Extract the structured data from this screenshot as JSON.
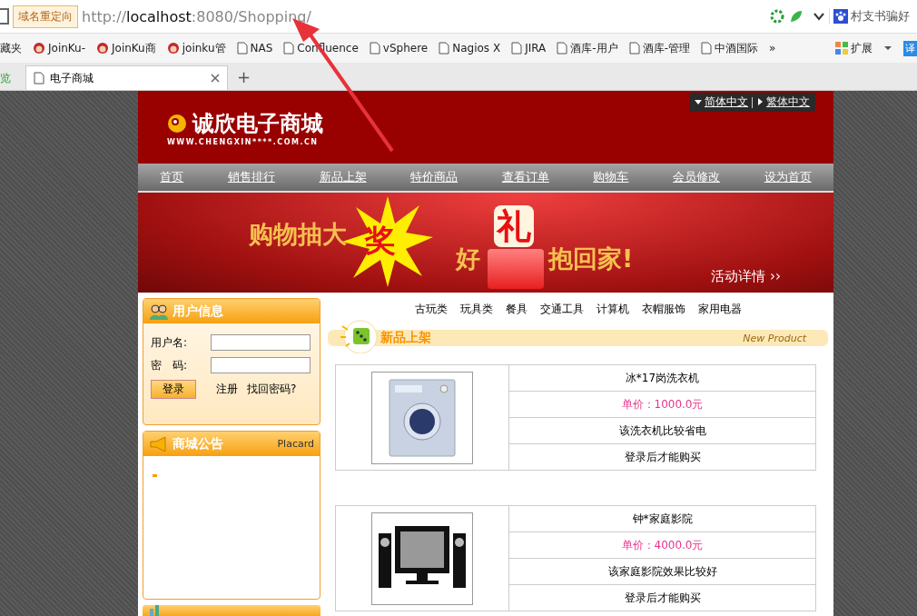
{
  "browser": {
    "redirect_badge": "域名重定向",
    "url_host": "localhost",
    "url_rest": ":8080/Shopping/",
    "url_scheme": "http://",
    "search_text": "村支书骗好",
    "bookmarks": [
      {
        "kind": "partial",
        "label": "藏夹"
      },
      {
        "kind": "monkey",
        "label": "JoinKu-"
      },
      {
        "kind": "monkey",
        "label": "JoinKu商"
      },
      {
        "kind": "monkey",
        "label": "joinku管"
      },
      {
        "kind": "page",
        "label": "NAS"
      },
      {
        "kind": "page",
        "label": "Confluence"
      },
      {
        "kind": "page",
        "label": "vSphere"
      },
      {
        "kind": "page",
        "label": "Nagios X"
      },
      {
        "kind": "page",
        "label": "JIRA"
      },
      {
        "kind": "page",
        "label": "酒库-用户"
      },
      {
        "kind": "page",
        "label": "酒库-管理"
      },
      {
        "kind": "page",
        "label": "中酒国际"
      }
    ],
    "more": "»",
    "extensions": "扩展",
    "translate": "译",
    "tabs": [
      {
        "label": "览",
        "selected": false
      },
      {
        "label": "电子商城",
        "selected": true
      }
    ],
    "new_tab": "+"
  },
  "header": {
    "logo": "诚欣电子商城",
    "logo_url": "WWW.CHENGXIN****.COM.CN",
    "languages": [
      {
        "label": "简体中文",
        "selected": true
      },
      {
        "label": "繁体中文",
        "selected": false
      }
    ]
  },
  "nav": [
    "首页",
    "销售排行",
    "新品上架",
    "特价商品",
    "查看订单",
    "购物车",
    "会员修改",
    "设为首页"
  ],
  "banner": {
    "headline": "购物抽大",
    "star_word": "奖",
    "gift_left": "好",
    "gift_word": "礼",
    "gift_right": "抱回家!",
    "details": "活动详情 ››"
  },
  "login": {
    "title": "用户信息",
    "username_label": "用户名:",
    "password_label": "密　码:",
    "login_button": "登录",
    "register": "注册",
    "forgot": "找回密码?"
  },
  "placard": {
    "title": "商城公告",
    "subtitle": "Placard"
  },
  "categories": [
    "古玩类",
    "玩具类",
    "餐具",
    "交通工具",
    "计算机",
    "衣帽服饰",
    "家用电器"
  ],
  "new_products": {
    "title": "新品上架",
    "subtitle": "New Product",
    "items": [
      {
        "kind": "washer",
        "name": "冰*17岗洗衣机",
        "price": "单价：1000.0元",
        "description": "该洗衣机比较省电",
        "note": "登录后才能购买"
      },
      {
        "kind": "theater",
        "name": "钟*家庭影院",
        "price": "单价：4000.0元",
        "description": "该家庭影院效果比较好",
        "note": "登录后才能购买"
      }
    ]
  }
}
